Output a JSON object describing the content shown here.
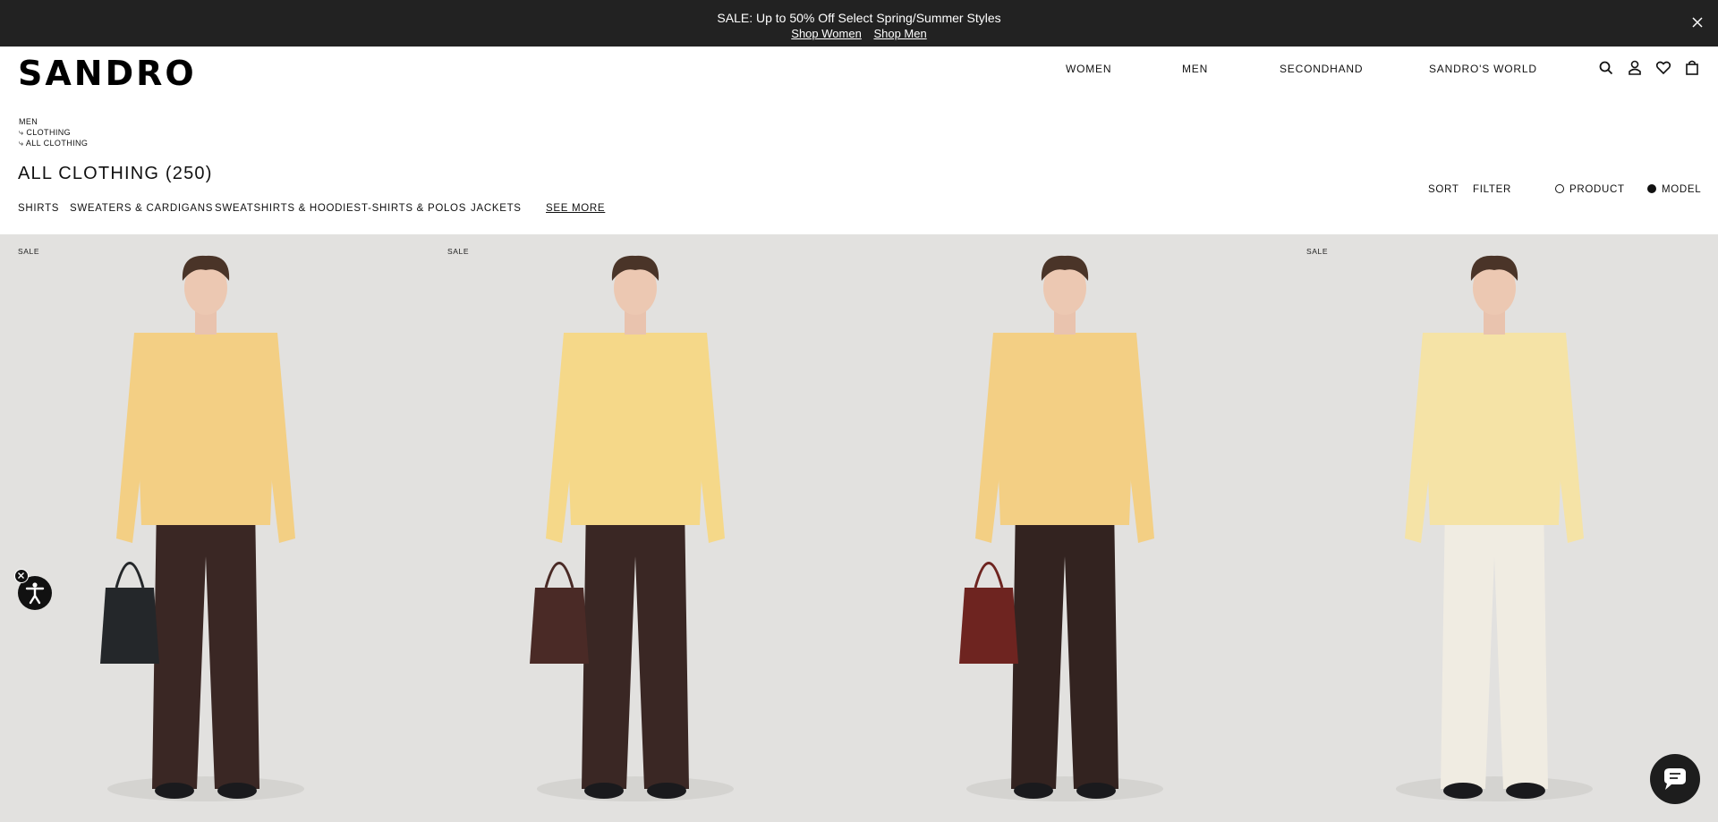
{
  "promo": {
    "message": "SALE: Up to 50% Off Select Spring/Summer Styles",
    "link_women": "Shop Women",
    "link_men": "Shop Men"
  },
  "header": {
    "logo": "SANDRO",
    "nav": [
      "WOMEN",
      "MEN",
      "SECONDHAND",
      "SANDRO'S WORLD"
    ]
  },
  "breadcrumb": [
    "MEN",
    "⤷ CLOTHING",
    "⤷ ALL CLOTHING"
  ],
  "page": {
    "title": "ALL CLOTHING (250)"
  },
  "categories": [
    "SHIRTS",
    "SWEATERS & CARDIGANS",
    "SWEATSHIRTS & HOODIES",
    "T-SHIRTS & POLOS",
    "JACKETS"
  ],
  "see_more": "SEE MORE",
  "controls": {
    "sort": "SORT",
    "filter": "FILTER",
    "view_product": "PRODUCT",
    "view_model": "MODEL",
    "selected_view": "MODEL"
  },
  "products": [
    {
      "badge": "SALE",
      "top_color": "#f3cf84",
      "pants_color": "#3a2724",
      "bag": "#24272a"
    },
    {
      "badge": "SALE",
      "top_color": "#f5d889",
      "pants_color": "#3a2724",
      "bag": "#4a2a26"
    },
    {
      "badge": "",
      "top_color": "#f3cf84",
      "pants_color": "#332320",
      "bag": "#6e2420"
    },
    {
      "badge": "SALE",
      "top_color": "#f5e3a6",
      "pants_color": "#f0ece2",
      "bag": ""
    }
  ],
  "icons": [
    "close-icon",
    "search-icon",
    "account-icon",
    "heart-icon",
    "bag-icon",
    "accessibility-icon",
    "chat-icon"
  ]
}
